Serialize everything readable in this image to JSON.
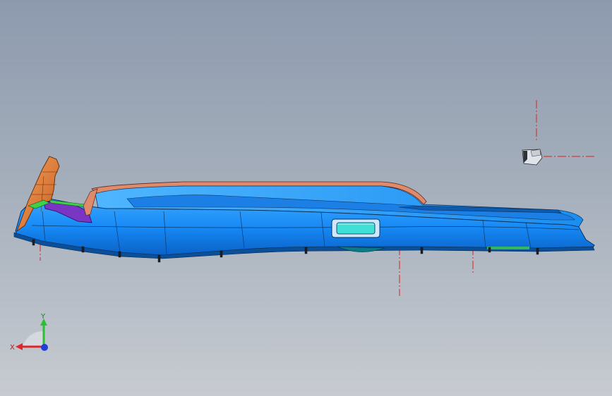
{
  "viewport": {
    "background_top": "#8d9aae",
    "background_bottom": "#c7cbd1"
  },
  "model": {
    "name": "",
    "part_colors": {
      "main_body": "#1e8fff",
      "rim": "#d9866a",
      "seat": "#e07a3a",
      "inner_panel": "#7a35c4",
      "accent": "#3fcf4a",
      "vent": "#3fe0d6"
    }
  },
  "triad": {
    "x_label": "X",
    "y_label": "Y",
    "x_color": "#e0262a",
    "y_color": "#2bbf35",
    "z_color": "#1f3fd8"
  },
  "construction_line_color": "#e02020"
}
